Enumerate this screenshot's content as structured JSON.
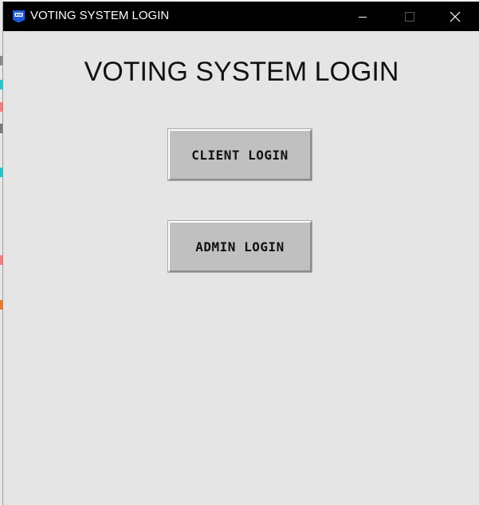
{
  "window": {
    "title": "VOTING SYSTEM LOGIN",
    "app_icon": "vote-app-icon",
    "controls": {
      "minimize_icon": "minimize-icon",
      "maximize_icon": "maximize-icon",
      "close_icon": "close-icon"
    },
    "colors": {
      "titlebar": "#000000",
      "client_area": "#e5e5e5",
      "button_face": "#c0c0c0",
      "app_icon_accent": "#1e5bd8"
    }
  },
  "main": {
    "heading": "VOTING SYSTEM LOGIN",
    "client_login_label": "CLIENT LOGIN",
    "admin_login_label": "ADMIN LOGIN"
  }
}
